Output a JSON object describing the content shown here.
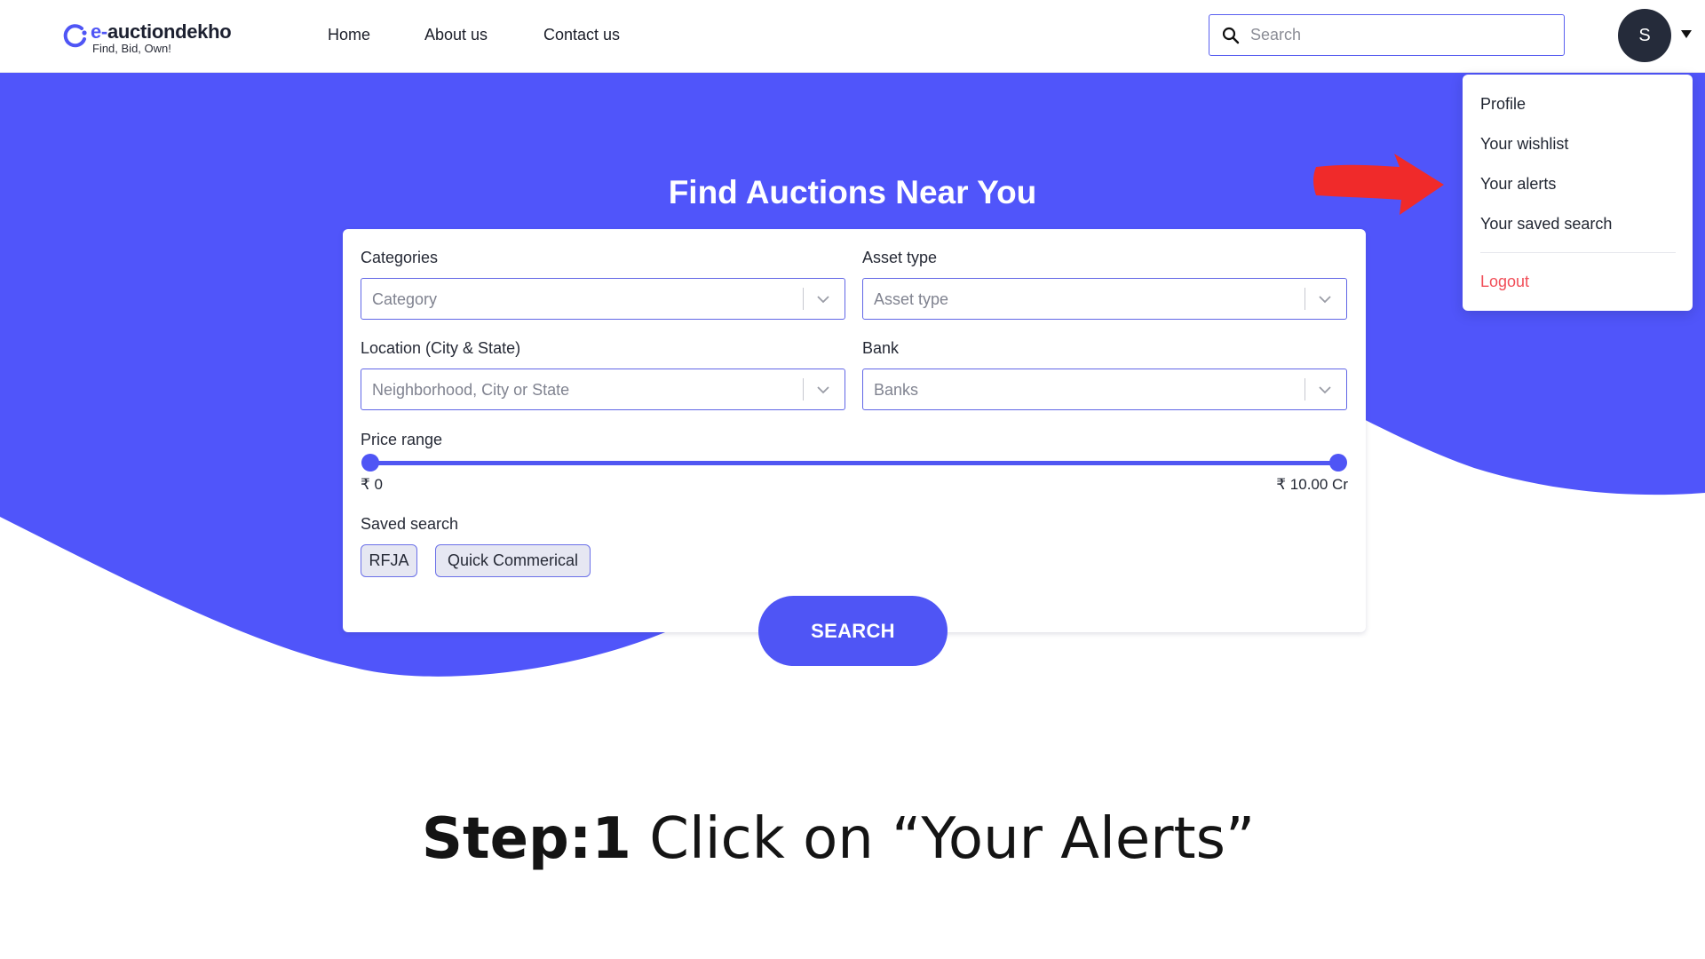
{
  "brand": {
    "name_prefix": "e-",
    "name_rest": "auctiondekho",
    "tagline": "Find, Bid, Own!",
    "color": "#4f55f5"
  },
  "nav": {
    "home": "Home",
    "about": "About us",
    "contact": "Contact us"
  },
  "header_search": {
    "placeholder": "Search",
    "icon": "search-icon"
  },
  "user": {
    "initial": "S"
  },
  "hero": {
    "title": "Find Auctions Near You",
    "color": "#5055fa"
  },
  "form": {
    "categories": {
      "label": "Categories",
      "placeholder": "Category"
    },
    "asset_type": {
      "label": "Asset type",
      "placeholder": "Asset type"
    },
    "location": {
      "label": "Location (City & State)",
      "placeholder": "Neighborhood, City or State"
    },
    "bank": {
      "label": "Bank",
      "placeholder": "Banks"
    },
    "price_range": {
      "label": "Price range",
      "min_label": "₹ 0",
      "max_label": "₹ 10.00 Cr",
      "low_fraction": 0,
      "high_fraction": 1
    },
    "saved_search": {
      "label": "Saved search",
      "chips": [
        "RFJA",
        "Quick Commerical"
      ]
    },
    "search_button": "SEARCH"
  },
  "user_menu": {
    "items": [
      "Profile",
      "Your wishlist",
      "Your alerts",
      "Your saved search"
    ],
    "logout": "Logout",
    "logout_color": "#f14e58"
  },
  "annotation": {
    "arrow_color": "#f02a2a",
    "step_bold": "Step:1",
    "step_text": " Click on “Your Alerts”"
  }
}
